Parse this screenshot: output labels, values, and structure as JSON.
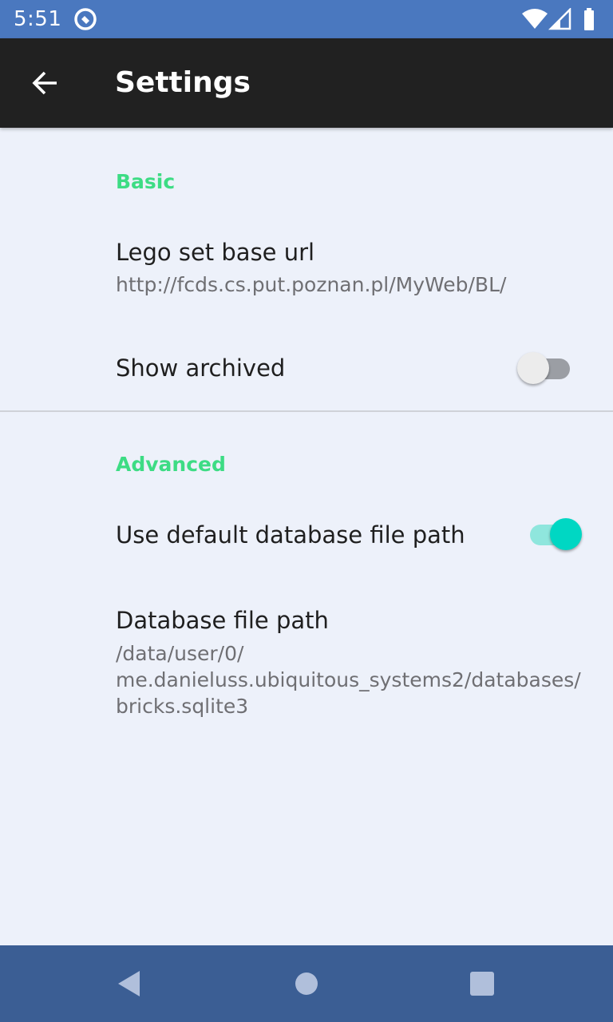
{
  "status_bar": {
    "time": "5:51",
    "icons": [
      "sync-icon",
      "wifi-icon",
      "cell-signal-icon",
      "battery-icon"
    ]
  },
  "app_bar": {
    "title": "Settings",
    "back_icon": "arrow-back-icon"
  },
  "categories": {
    "basic": {
      "title": "Basic",
      "url_pref": {
        "title": "Lego set base url",
        "summary": "http://fcds.cs.put.poznan.pl/MyWeb/BL/"
      },
      "archived_pref": {
        "title": "Show archived",
        "enabled": false
      }
    },
    "advanced": {
      "title": "Advanced",
      "default_path_pref": {
        "title": "Use default database file path",
        "enabled": true
      },
      "db_path_pref": {
        "title": "Database file path",
        "summary_line1": "/data/user/0/",
        "summary_line2": "me.danieluss.ubiquitous_systems2/databases/",
        "summary_line3": "bricks.sqlite3"
      }
    }
  },
  "colors": {
    "status_bar": "#4a78bf",
    "app_bar": "#212121",
    "background": "#edf1fa",
    "category_accent": "#3ddc84",
    "switch_on_thumb": "#00d7c3",
    "switch_on_track": "#8fe6dd",
    "switch_off_thumb": "#ececec",
    "switch_off_track": "#9b9ea4",
    "nav_bar": "#3b5e94"
  },
  "nav_bar": {
    "buttons": [
      "back-triangle-icon",
      "home-circle-icon",
      "recents-square-icon"
    ]
  }
}
